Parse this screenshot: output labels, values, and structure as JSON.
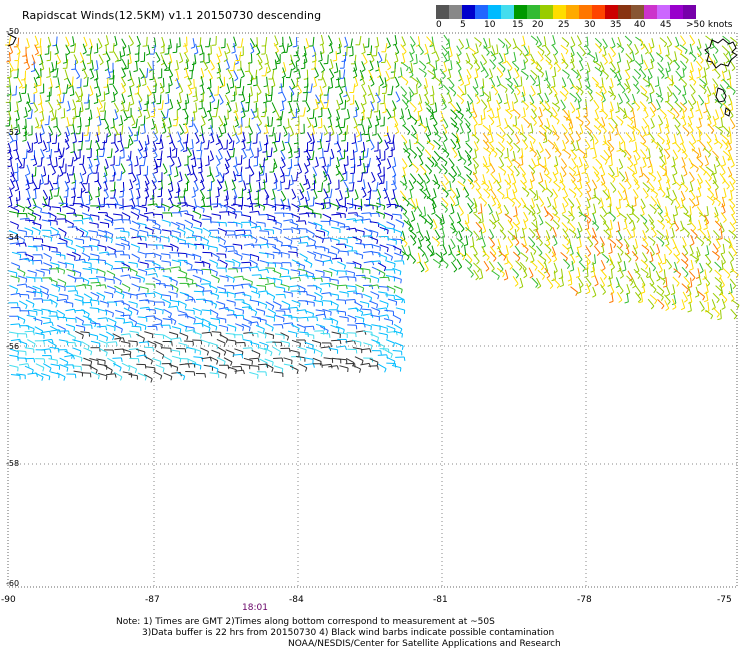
{
  "title": "Rapidscat Winds(12.5KM) v1.1 20150730 descending",
  "legend": {
    "colors": [
      "#555555",
      "#888888",
      "#0000cc",
      "#2266ff",
      "#00bbff",
      "#44ddee",
      "#009900",
      "#33bb33",
      "#99cc00",
      "#ffdd00",
      "#ffaa00",
      "#ff7700",
      "#ff4400",
      "#cc0000",
      "#883311",
      "#885533",
      "#cc33cc",
      "#cc66ff",
      "#9900cc",
      "#7700aa"
    ],
    "ticks": [
      "0",
      "5",
      "10",
      "15",
      "20",
      "25",
      "30",
      "35",
      "40",
      "45",
      ">50 knots"
    ]
  },
  "axes": {
    "x_labels": [
      "-90",
      "-87",
      "-84",
      "-81",
      "-78",
      "-75"
    ],
    "y_labels": [
      "-50",
      "-52",
      "-54",
      "-56",
      "-58",
      "-60"
    ]
  },
  "time_label": "18:01",
  "notes": {
    "line1": "Note: 1) Times are GMT 2)Times along bottom correspond to measurement at ~50S",
    "line2": "3)Data buffer is 22 hrs from 20150730 4) Black wind barbs indicate possible contamination",
    "line3": "NOAA/NESDIS/Center for Satellite Applications and Research"
  }
}
